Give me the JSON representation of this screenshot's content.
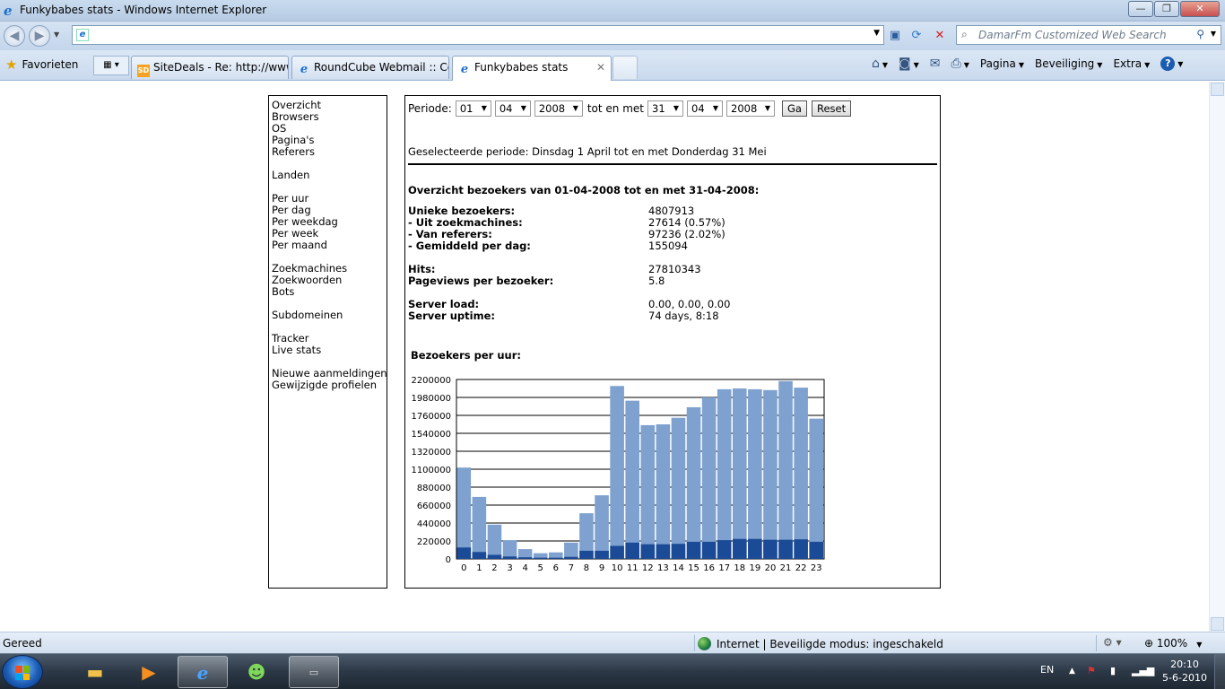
{
  "window": {
    "title": "Funkybabes stats - Windows Internet Explorer",
    "minimize": "—",
    "maximize": "❐",
    "close": "✕"
  },
  "address": {
    "value": ""
  },
  "search": {
    "placeholder": "DamarFm Customized Web Search"
  },
  "favorites_label": "Favorieten",
  "tabs": [
    {
      "label": "SiteDeals - Re: http://www....",
      "icon": "sitedeals-icon"
    },
    {
      "label": "RoundCube Webmail :: Co...",
      "icon": "ie-page-icon"
    },
    {
      "label": "Funkybabes stats",
      "icon": "ie-page-icon",
      "active": true
    }
  ],
  "command_bar": {
    "page": "Pagina",
    "safety": "Beveiliging",
    "tools": "Extra"
  },
  "menu": {
    "group1": [
      "Overzicht",
      "Browsers",
      "OS",
      "Pagina's",
      "Referers"
    ],
    "group2": [
      "Landen"
    ],
    "group3": [
      "Per uur",
      "Per dag",
      "Per weekdag",
      "Per week",
      "Per maand"
    ],
    "group4": [
      "Zoekmachines",
      "Zoekwoorden",
      "Bots"
    ],
    "group5": [
      "Subdomeinen"
    ],
    "group6": [
      "Tracker",
      "Live stats"
    ],
    "group7": [
      "Nieuwe aanmeldingen",
      "Gewijzigde profielen"
    ]
  },
  "period": {
    "label": "Periode:",
    "from_day": "01",
    "from_month": "04",
    "from_year": "2008",
    "until_label": "tot en met",
    "to_day": "31",
    "to_month": "04",
    "to_year": "2008",
    "go": "Ga",
    "reset": "Reset"
  },
  "selected_period": "Geselecteerde periode: Dinsdag 1 April tot en met Donderdag 31 Mei",
  "overview_title": "Overzicht bezoekers van 01-04-2008 tot en met 31-04-2008:",
  "stats": [
    {
      "key": "Unieke bezoekers:",
      "value": "4807913"
    },
    {
      "key": "- Uit zoekmachines:",
      "value": "27614 (0.57%)"
    },
    {
      "key": "- Van referers:",
      "value": "97236 (2.02%)"
    },
    {
      "key": "- Gemiddeld per dag:",
      "value": "155094"
    },
    {
      "key": "Hits:",
      "value": "27810343"
    },
    {
      "key": "Pageviews per bezoeker:",
      "value": "5.8"
    },
    {
      "key": "Server load:",
      "value": "0.00, 0.00, 0.00"
    },
    {
      "key": "Server uptime:",
      "value": "74 days, 8:18"
    }
  ],
  "chart_title": "Bezoekers per uur:",
  "chart_data": {
    "type": "bar",
    "categories": [
      "0",
      "1",
      "2",
      "3",
      "4",
      "5",
      "6",
      "7",
      "8",
      "9",
      "10",
      "11",
      "12",
      "13",
      "14",
      "15",
      "16",
      "17",
      "18",
      "19",
      "20",
      "21",
      "22",
      "23"
    ],
    "series": [
      {
        "values": [
          140000,
          85000,
          50000,
          30000,
          20000,
          15000,
          15000,
          25000,
          100000,
          100000,
          160000,
          200000,
          180000,
          180000,
          185000,
          210000,
          210000,
          230000,
          245000,
          245000,
          235000,
          235000,
          240000,
          210000
        ]
      },
      {
        "values": [
          1120000,
          760000,
          420000,
          230000,
          120000,
          70000,
          80000,
          200000,
          560000,
          780000,
          2120000,
          1940000,
          1640000,
          1650000,
          1730000,
          1860000,
          1980000,
          2080000,
          2090000,
          2080000,
          2070000,
          2180000,
          2100000,
          1720000
        ]
      }
    ],
    "ylim": [
      0,
      2200000
    ],
    "yticks": [
      "2200000",
      "1980000",
      "1760000",
      "1540000",
      "1320000",
      "1100000",
      "880000",
      "660000",
      "440000",
      "220000",
      "0"
    ],
    "colors": {
      "lower": "#1b4a96",
      "upper": "#7ea1cf"
    },
    "grid": true,
    "stacked": false
  },
  "status": {
    "text": "Gereed",
    "zone": "Internet | Beveiligde modus: ingeschakeld",
    "zoom": "100%"
  },
  "taskbar": {
    "lang": "EN",
    "time": "20:10",
    "date": "5-6-2010"
  }
}
